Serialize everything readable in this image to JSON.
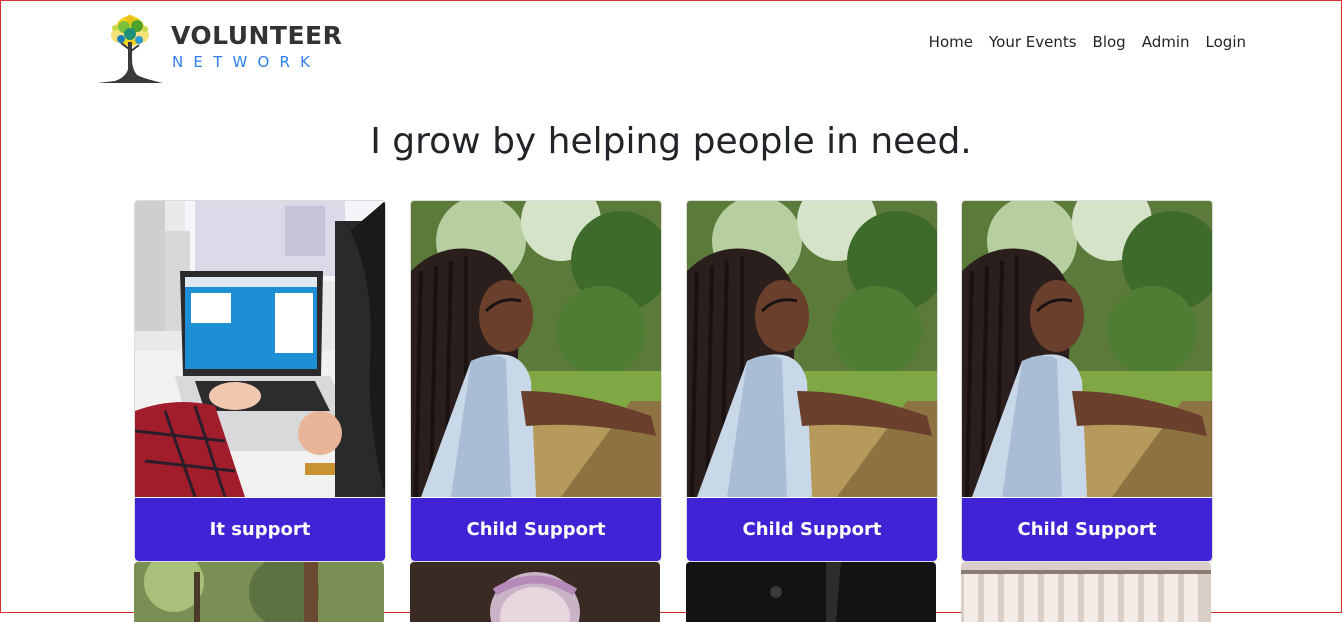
{
  "logo": {
    "title": "VOLUNTEER",
    "subtitle": "NETWORK"
  },
  "nav": {
    "items": [
      {
        "label": "Home"
      },
      {
        "label": "Your Events"
      },
      {
        "label": "Blog"
      },
      {
        "label": "Admin"
      },
      {
        "label": "Login"
      }
    ]
  },
  "hero": {
    "title": "I grow by helping people in need."
  },
  "cards": [
    {
      "label": "It support"
    },
    {
      "label": "Child Support"
    },
    {
      "label": "Child Support"
    },
    {
      "label": "Child Support"
    }
  ],
  "colors": {
    "accent": "#3f23d4",
    "logo_blue": "#2f80ed",
    "text": "#212529"
  }
}
